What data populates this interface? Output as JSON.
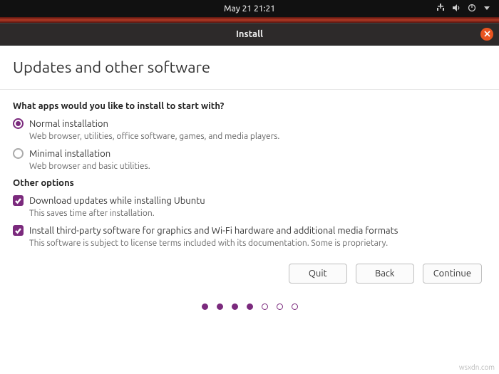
{
  "topbar": {
    "datetime": "May 21  21:21"
  },
  "window": {
    "title": "Install"
  },
  "page": {
    "title": "Updates and other software"
  },
  "question": "What apps would you like to install to start with?",
  "options": {
    "normal": {
      "label": "Normal installation",
      "desc": "Web browser, utilities, office software, games, and media players.",
      "selected": true
    },
    "minimal": {
      "label": "Minimal installation",
      "desc": "Web browser and basic utilities.",
      "selected": false
    }
  },
  "other_title": "Other options",
  "other": {
    "updates": {
      "label": "Download updates while installing Ubuntu",
      "desc": "This saves time after installation.",
      "checked": true
    },
    "thirdparty": {
      "label": "Install third-party software for graphics and Wi-Fi hardware and additional media formats",
      "desc": "This software is subject to license terms included with its documentation. Some is proprietary.",
      "checked": true
    }
  },
  "buttons": {
    "quit": "Quit",
    "back": "Back",
    "continue": "Continue"
  },
  "progress": {
    "total": 7,
    "current": 4
  },
  "watermark": "wsxdn.com"
}
